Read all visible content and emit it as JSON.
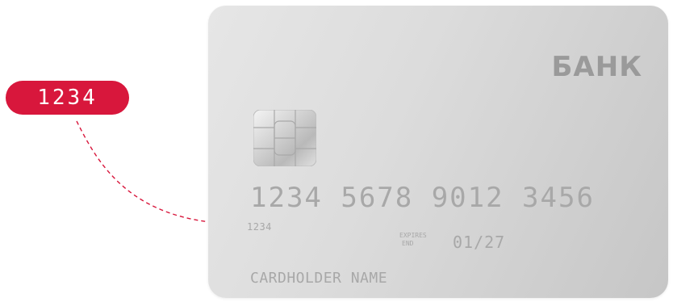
{
  "badge": {
    "text": "1234"
  },
  "card": {
    "bank_name": "БАНК",
    "number": "1234 5678 9012 3456",
    "number_short": "1234",
    "expires_label_top": "EXPIRES",
    "expires_label_bottom": "END",
    "expiry": "01/27",
    "holder_name": "CARDHOLDER NAME"
  },
  "colors": {
    "accent": "#d8173c",
    "card_text": "#a8a8a8",
    "bank_text": "#9a9a9a"
  },
  "icons": {
    "chip": "emv-chip-icon"
  }
}
